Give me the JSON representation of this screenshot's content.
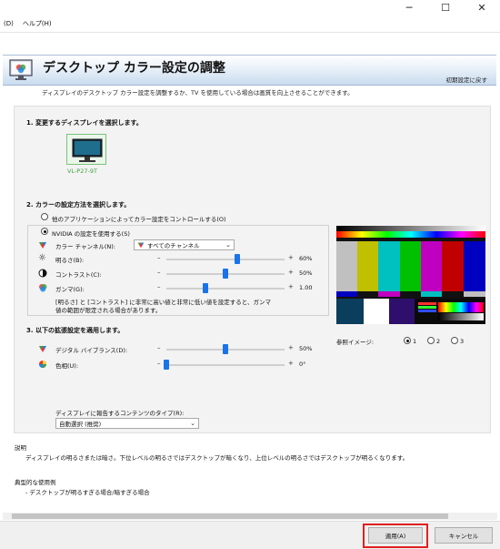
{
  "window": {
    "minimize_glyph": "─",
    "maximize_glyph": "☐",
    "close_glyph": "✕"
  },
  "menu": [
    {
      "label": "(D)"
    },
    {
      "label": "ヘルプ(H)"
    }
  ],
  "header": {
    "title": "デスクトップ カラー設定の調整",
    "reset_label": "初期設定に戻す",
    "icon": "display-color-icon"
  },
  "subtitle": "ディスプレイのデスクトップ カラー設定を調整するか、TV を使用している場合は画質を向上させることができます。",
  "section1": {
    "title": "1. 変更するディスプレイを選択します。",
    "display_name": "VL-P27-9T"
  },
  "section2": {
    "title": "2. カラーの設定方法を選択します。",
    "option_other": "他のアプリケーションによってカラー設定をコントロールする(O)",
    "option_nvidia": "NVIDIA の設定を使用する(S)",
    "selected_option": "nvidia",
    "channel_label": "カラー チャンネル(N):",
    "channel_value": "すべてのチャンネル",
    "brightness": {
      "label": "明るさ(B):",
      "value_text": "60%",
      "level": 0.6
    },
    "contrast": {
      "label": "コントラスト(C):",
      "value_text": "50%",
      "level": 0.5
    },
    "gamma": {
      "label": "ガンマ(G):",
      "value_text": "1.00",
      "level": 0.33
    },
    "warning": "[明るさ] と [コントラスト] に非常に高い値と非常に低い値を設定すると、ガンマ値の範囲が限定される場合があります。"
  },
  "section3": {
    "title": "3. 以下の拡張設定を適用します。",
    "vibrance": {
      "label": "デジタル バイブランス(D):",
      "value_text": "50%",
      "level": 0.5
    },
    "hue": {
      "label": "色相(U):",
      "value_text": "0°",
      "level": 0.0
    },
    "content_type_label": "ディスプレイに報告するコンテンツのタイプ(R):",
    "content_type_value": "自動選択 (推奨)"
  },
  "reference": {
    "label": "参照イメージ:",
    "options": [
      "1",
      "2",
      "3"
    ],
    "selected": "1"
  },
  "description": {
    "title": "説明",
    "text": "ディスプレイの明るさまたは暗さ。下位レベルの明るさではデスクトップが暗くなり、上位レベルの明るさではデスクトップが明るくなります。",
    "usage_title": "典型的な使用例",
    "usage_item": "- デスクトップが明るすぎる場合/暗すぎる場合"
  },
  "buttons": {
    "apply": "適用(A)",
    "cancel": "キャンセル"
  },
  "colors": {
    "accent": "#1a73e8",
    "nvidia_green": "#76b900",
    "highlight": "#e02020"
  }
}
